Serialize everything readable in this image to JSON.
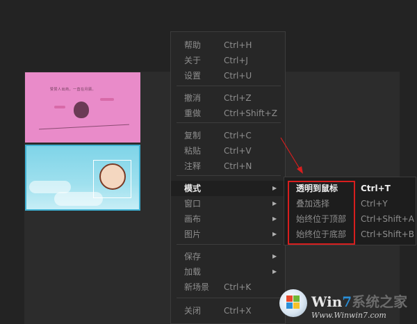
{
  "menu": {
    "groups": [
      [
        {
          "label": "帮助",
          "shortcut": "Ctrl+H"
        },
        {
          "label": "关于",
          "shortcut": "Ctrl+J"
        },
        {
          "label": "设置",
          "shortcut": "Ctrl+U"
        }
      ],
      [
        {
          "label": "撤消",
          "shortcut": "Ctrl+Z"
        },
        {
          "label": "重做",
          "shortcut": "Ctrl+Shift+Z"
        }
      ],
      [
        {
          "label": "复制",
          "shortcut": "Ctrl+C"
        },
        {
          "label": "粘贴",
          "shortcut": "Ctrl+V"
        },
        {
          "label": "注释",
          "shortcut": "Ctrl+N"
        }
      ],
      [
        {
          "label": "模式",
          "submenu": true,
          "active": true
        },
        {
          "label": "窗口",
          "submenu": true
        },
        {
          "label": "画布",
          "submenu": true
        },
        {
          "label": "图片",
          "submenu": true
        }
      ],
      [
        {
          "label": "保存",
          "submenu": true
        },
        {
          "label": "加载",
          "submenu": true
        },
        {
          "label": "新场景",
          "shortcut": "Ctrl+K"
        }
      ],
      [
        {
          "label": "关闭",
          "shortcut": "Ctrl+X"
        }
      ]
    ]
  },
  "submenu": {
    "items": [
      {
        "label": "透明到鼠标",
        "shortcut": "Ctrl+T",
        "strong": true
      },
      {
        "label": "叠加选择",
        "shortcut": "Ctrl+Y"
      },
      {
        "label": "始终位于顶部",
        "shortcut": "Ctrl+Shift+A"
      },
      {
        "label": "始终位于底部",
        "shortcut": "Ctrl+Shift+B"
      }
    ]
  },
  "thumbnails": {
    "pink_caption": "赞赞人出商，一直在月顾。"
  },
  "watermark": {
    "brand_win": "Win",
    "brand_seven": "7",
    "brand_rest": "系统之家",
    "url": "Www.Winwin7.com"
  },
  "colors": {
    "background": "#232323",
    "menu_bg": "#272727",
    "menu_text": "#8e8e8e",
    "active_text": "#ececec",
    "highlight": "#d81e1e",
    "pink_thumb": "#e98bc9",
    "blue_thumb_border": "#3fb0d2"
  }
}
